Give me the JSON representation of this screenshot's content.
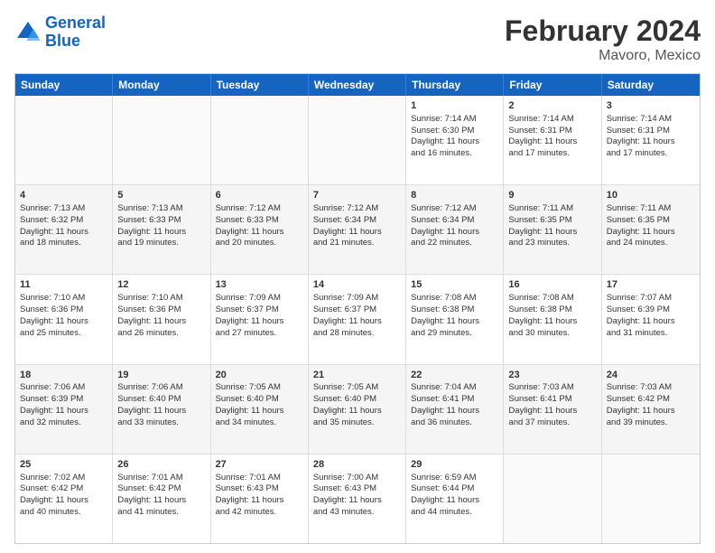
{
  "header": {
    "logo_line1": "General",
    "logo_line2": "Blue",
    "title": "February 2024",
    "subtitle": "Mavoro, Mexico"
  },
  "weekdays": [
    "Sunday",
    "Monday",
    "Tuesday",
    "Wednesday",
    "Thursday",
    "Friday",
    "Saturday"
  ],
  "weeks": [
    [
      {
        "day": "",
        "data": ""
      },
      {
        "day": "",
        "data": ""
      },
      {
        "day": "",
        "data": ""
      },
      {
        "day": "",
        "data": ""
      },
      {
        "day": "1",
        "data": "Sunrise: 7:14 AM\nSunset: 6:30 PM\nDaylight: 11 hours\nand 16 minutes."
      },
      {
        "day": "2",
        "data": "Sunrise: 7:14 AM\nSunset: 6:31 PM\nDaylight: 11 hours\nand 17 minutes."
      },
      {
        "day": "3",
        "data": "Sunrise: 7:14 AM\nSunset: 6:31 PM\nDaylight: 11 hours\nand 17 minutes."
      }
    ],
    [
      {
        "day": "4",
        "data": "Sunrise: 7:13 AM\nSunset: 6:32 PM\nDaylight: 11 hours\nand 18 minutes."
      },
      {
        "day": "5",
        "data": "Sunrise: 7:13 AM\nSunset: 6:33 PM\nDaylight: 11 hours\nand 19 minutes."
      },
      {
        "day": "6",
        "data": "Sunrise: 7:12 AM\nSunset: 6:33 PM\nDaylight: 11 hours\nand 20 minutes."
      },
      {
        "day": "7",
        "data": "Sunrise: 7:12 AM\nSunset: 6:34 PM\nDaylight: 11 hours\nand 21 minutes."
      },
      {
        "day": "8",
        "data": "Sunrise: 7:12 AM\nSunset: 6:34 PM\nDaylight: 11 hours\nand 22 minutes."
      },
      {
        "day": "9",
        "data": "Sunrise: 7:11 AM\nSunset: 6:35 PM\nDaylight: 11 hours\nand 23 minutes."
      },
      {
        "day": "10",
        "data": "Sunrise: 7:11 AM\nSunset: 6:35 PM\nDaylight: 11 hours\nand 24 minutes."
      }
    ],
    [
      {
        "day": "11",
        "data": "Sunrise: 7:10 AM\nSunset: 6:36 PM\nDaylight: 11 hours\nand 25 minutes."
      },
      {
        "day": "12",
        "data": "Sunrise: 7:10 AM\nSunset: 6:36 PM\nDaylight: 11 hours\nand 26 minutes."
      },
      {
        "day": "13",
        "data": "Sunrise: 7:09 AM\nSunset: 6:37 PM\nDaylight: 11 hours\nand 27 minutes."
      },
      {
        "day": "14",
        "data": "Sunrise: 7:09 AM\nSunset: 6:37 PM\nDaylight: 11 hours\nand 28 minutes."
      },
      {
        "day": "15",
        "data": "Sunrise: 7:08 AM\nSunset: 6:38 PM\nDaylight: 11 hours\nand 29 minutes."
      },
      {
        "day": "16",
        "data": "Sunrise: 7:08 AM\nSunset: 6:38 PM\nDaylight: 11 hours\nand 30 minutes."
      },
      {
        "day": "17",
        "data": "Sunrise: 7:07 AM\nSunset: 6:39 PM\nDaylight: 11 hours\nand 31 minutes."
      }
    ],
    [
      {
        "day": "18",
        "data": "Sunrise: 7:06 AM\nSunset: 6:39 PM\nDaylight: 11 hours\nand 32 minutes."
      },
      {
        "day": "19",
        "data": "Sunrise: 7:06 AM\nSunset: 6:40 PM\nDaylight: 11 hours\nand 33 minutes."
      },
      {
        "day": "20",
        "data": "Sunrise: 7:05 AM\nSunset: 6:40 PM\nDaylight: 11 hours\nand 34 minutes."
      },
      {
        "day": "21",
        "data": "Sunrise: 7:05 AM\nSunset: 6:40 PM\nDaylight: 11 hours\nand 35 minutes."
      },
      {
        "day": "22",
        "data": "Sunrise: 7:04 AM\nSunset: 6:41 PM\nDaylight: 11 hours\nand 36 minutes."
      },
      {
        "day": "23",
        "data": "Sunrise: 7:03 AM\nSunset: 6:41 PM\nDaylight: 11 hours\nand 37 minutes."
      },
      {
        "day": "24",
        "data": "Sunrise: 7:03 AM\nSunset: 6:42 PM\nDaylight: 11 hours\nand 39 minutes."
      }
    ],
    [
      {
        "day": "25",
        "data": "Sunrise: 7:02 AM\nSunset: 6:42 PM\nDaylight: 11 hours\nand 40 minutes."
      },
      {
        "day": "26",
        "data": "Sunrise: 7:01 AM\nSunset: 6:42 PM\nDaylight: 11 hours\nand 41 minutes."
      },
      {
        "day": "27",
        "data": "Sunrise: 7:01 AM\nSunset: 6:43 PM\nDaylight: 11 hours\nand 42 minutes."
      },
      {
        "day": "28",
        "data": "Sunrise: 7:00 AM\nSunset: 6:43 PM\nDaylight: 11 hours\nand 43 minutes."
      },
      {
        "day": "29",
        "data": "Sunrise: 6:59 AM\nSunset: 6:44 PM\nDaylight: 11 hours\nand 44 minutes."
      },
      {
        "day": "",
        "data": ""
      },
      {
        "day": "",
        "data": ""
      }
    ]
  ]
}
